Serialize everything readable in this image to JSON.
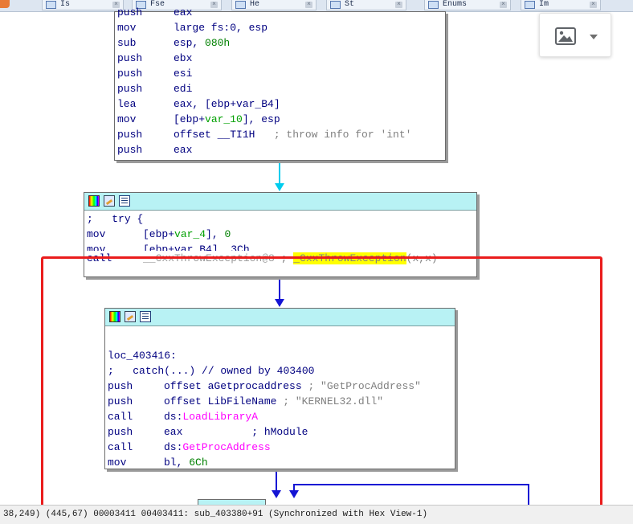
{
  "tabs": [
    {
      "label": "Is"
    },
    {
      "label": "Fse"
    },
    {
      "label": "He"
    },
    {
      "label": "St"
    },
    {
      "label": "Enums"
    },
    {
      "label": "Im"
    }
  ],
  "tab_close_glyph": "×",
  "icons": {
    "image_button": "image-icon",
    "caret": "chevron-down-icon"
  },
  "node1": {
    "lines": [
      {
        "m": "push",
        "o": "eax"
      },
      {
        "m": "mov",
        "o": "large fs:0, esp"
      },
      {
        "m": "sub",
        "o": "esp, ",
        "num": "080h"
      },
      {
        "m": "push",
        "o": "ebx"
      },
      {
        "m": "push",
        "o": "esi"
      },
      {
        "m": "push",
        "o": "edi"
      },
      {
        "m": "lea",
        "o": "eax, [ebp+var_B4]"
      },
      {
        "m": "mov",
        "o_pre": "[ebp+",
        "var": "var_10",
        "o_post": "], esp"
      },
      {
        "m": "push",
        "o": "offset __TI1H",
        "comment": "   ; throw info for 'int'"
      },
      {
        "m": "push",
        "o": "eax"
      }
    ]
  },
  "node2": {
    "try_line_semi": ";",
    "try_line_text": "   try {",
    "lines": [
      {
        "m": "mov",
        "o_pre": "[ebp+",
        "var": "var_4",
        "o_post": "], ",
        "num": "0"
      },
      {
        "m": "mov",
        "o": "[ebp+var_B4], 3Ch"
      }
    ],
    "call": {
      "m": "call",
      "target": "__CxxThrowException@8",
      "sep": " ; ",
      "hl": "_CxxThrowException",
      "rest": "(x,x)"
    }
  },
  "node3": {
    "label": "loc_403416:",
    "catch_semi": ";",
    "catch_text": "   catch(...) // owned by 403400",
    "lines": [
      {
        "m": "push",
        "o": "offset aGetprocaddress",
        "comment": " ; \"GetProcAddress\""
      },
      {
        "m": "push",
        "o": "offset LibFileName",
        "comment": " ; \"KERNEL32.dll\""
      },
      {
        "m": "call",
        "o_pre": "ds:",
        "fn": "LoadLibraryA"
      },
      {
        "m": "push",
        "o": "eax",
        "comment": "           ; hModule"
      },
      {
        "m": "call",
        "o_pre": "ds:",
        "fn": "GetProcAddress"
      },
      {
        "m": "mov",
        "o": "bl, ",
        "num": "6Ch"
      }
    ]
  },
  "status": {
    "text": "38,249) (445,67) 00003411 00403411: sub_403380+91 (Synchronized with Hex View-1)"
  },
  "colors": {
    "header_bg": "#b8f2f4",
    "edge_cyan": "#00ccee",
    "edge_blue": "#1414d4",
    "selection_red": "#ea1c1c",
    "highlight": "#ffff00"
  }
}
